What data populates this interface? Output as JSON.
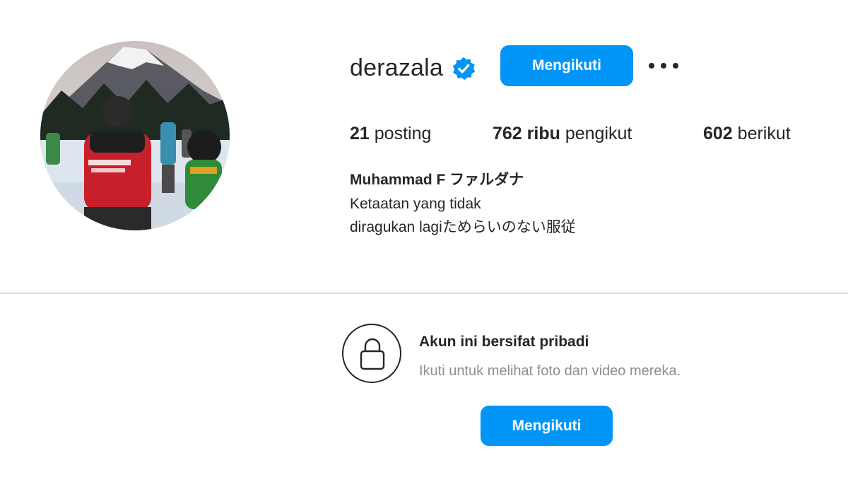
{
  "profile": {
    "username": "derazala",
    "verified": true,
    "follow_label": "Mengikuti",
    "more_icon": "more-options-icon",
    "stats": {
      "posts_count": "21",
      "posts_label": "posting",
      "followers_count": "762 ribu",
      "followers_label": "pengikut",
      "following_count": "602",
      "following_label": "berikut"
    },
    "full_name": "Muhammad F ファルダナ",
    "bio": [
      "Ketaatan yang tidak",
      "diragukan lagiためらいのない服従"
    ]
  },
  "private_notice": {
    "icon": "lock-icon",
    "title": "Akun ini bersifat pribadi",
    "subtitle": "Ikuti untuk melihat foto dan video mereka.",
    "follow_label": "Mengikuti"
  },
  "colors": {
    "accent": "#0095f6",
    "text": "#262626",
    "muted": "#8e8e8e",
    "divider": "#dbdbdb"
  }
}
